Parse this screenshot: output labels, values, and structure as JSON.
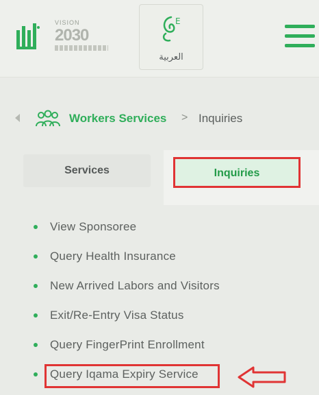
{
  "header": {
    "logo_text": "أبشر",
    "vision": {
      "label": "VISION",
      "year": "2030"
    },
    "language_button": "العربية"
  },
  "breadcrumb": {
    "section": "Workers Services",
    "separator": ">",
    "current": "Inquiries"
  },
  "tabs": [
    {
      "label": "Services",
      "active": false
    },
    {
      "label": "Inquiries",
      "active": true
    }
  ],
  "inquiries": [
    "View Sponsoree",
    "Query Health Insurance",
    "New Arrived Labors and Visitors",
    "Exit/Re-Entry Visa Status",
    "Query FingerPrint Enrollment",
    "Query Iqama Expiry Service"
  ],
  "colors": {
    "accent": "#2fae5a",
    "highlight": "#e03434"
  }
}
